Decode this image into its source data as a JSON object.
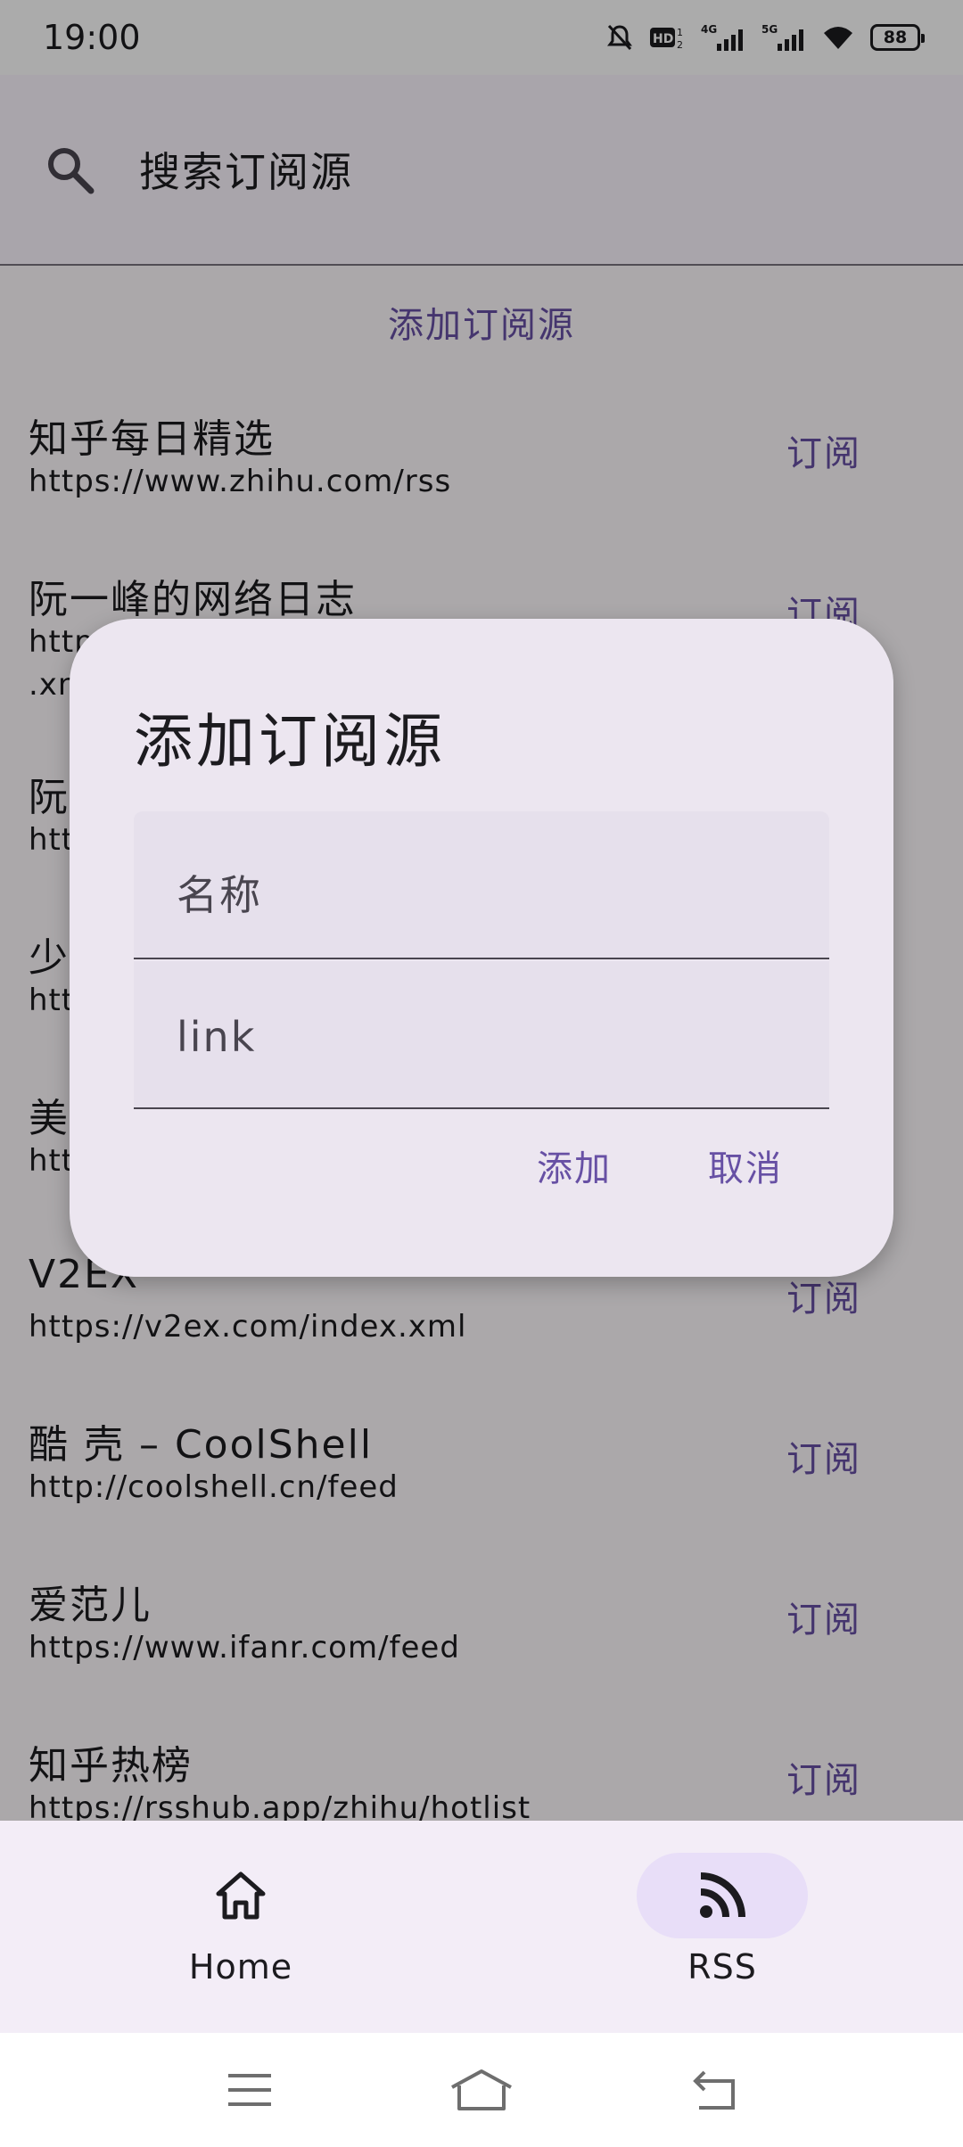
{
  "status_bar": {
    "time": "19:00",
    "battery": "88",
    "network_1": "4G",
    "network_2": "5G"
  },
  "search": {
    "placeholder": "搜索订阅源"
  },
  "content": {
    "add_source_label": "添加订阅源",
    "feeds": [
      {
        "title": "知乎每日精选",
        "url": "https://www.zhihu.com/rss",
        "action": "订阅"
      },
      {
        "title": "阮一峰的网络日志",
        "url": "http",
        "url_2": ".xn",
        "action": "订阅"
      },
      {
        "title": "阮",
        "url": "htt",
        "action": ""
      },
      {
        "title": "少",
        "url": "htt",
        "action": ""
      },
      {
        "title": "美",
        "url": "htt",
        "action": ""
      },
      {
        "title": "V2EX",
        "url": "https://v2ex.com/index.xml",
        "action": "订阅"
      },
      {
        "title": "酷 壳 – CoolShell",
        "url": "http://coolshell.cn/feed",
        "action": "订阅"
      },
      {
        "title": "爱范儿",
        "url": "https://www.ifanr.com/feed",
        "action": "订阅"
      },
      {
        "title": "知乎热榜",
        "url": "https://rsshub.app/zhihu/hotlist",
        "action": "订阅"
      }
    ]
  },
  "dialog": {
    "title": "添加订阅源",
    "name_placeholder": "名称",
    "link_placeholder": "link",
    "add_button": "添加",
    "cancel_button": "取消"
  },
  "bottom_nav": {
    "items": [
      {
        "label": "Home",
        "icon": "home-icon",
        "selected": false
      },
      {
        "label": "RSS",
        "icon": "rss-icon",
        "selected": true
      }
    ]
  },
  "colors": {
    "primary": "#6750a4",
    "surface": "#fffbfe",
    "dialog": "#ece6f0",
    "nav_indicator": "#e8def8"
  }
}
